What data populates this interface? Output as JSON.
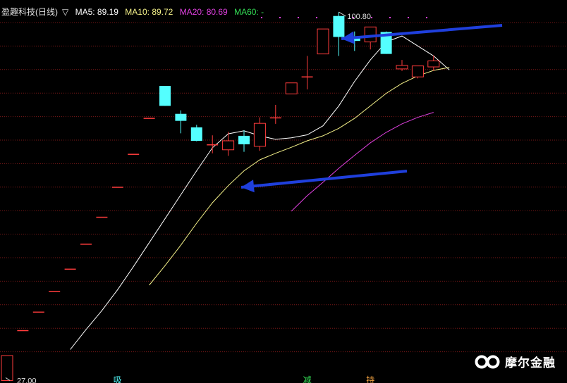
{
  "header": {
    "name": "盈趣科技(日线)",
    "marker": "▽",
    "ma5_label": "MA5: 89.19",
    "ma10_label": "MA10: 89.72",
    "ma20_label": "MA20: 80.69",
    "ma60_label": "MA60: -"
  },
  "watermark": {
    "text": "摩尔金融",
    "logo": "infinity-logo"
  },
  "colors": {
    "up": "#ff3c3c",
    "down": "#54ffff",
    "ma5": "#ffffff",
    "ma10": "#f5f28a",
    "ma20": "#e040e0",
    "arrow": "#1f3fdc",
    "grid": "#7a1818"
  },
  "chart_data": {
    "type": "candlestick",
    "ylim": [
      26.5,
      103.2
    ],
    "annotations": {
      "high_label": "100.80",
      "low_label": "27.00"
    },
    "candles": [
      {
        "o": 27.0,
        "c": 32.0,
        "h": 32.0,
        "l": 27.0
      },
      {
        "o": 37.1,
        "c": 37.1,
        "h": 37.1,
        "l": 37.1
      },
      {
        "o": 40.8,
        "c": 40.8,
        "h": 40.8,
        "l": 40.8
      },
      {
        "o": 44.9,
        "c": 44.9,
        "h": 44.9,
        "l": 44.9
      },
      {
        "o": 49.4,
        "c": 49.4,
        "h": 49.4,
        "l": 49.4
      },
      {
        "o": 54.4,
        "c": 54.4,
        "h": 54.4,
        "l": 54.4
      },
      {
        "o": 59.8,
        "c": 59.8,
        "h": 59.8,
        "l": 59.8
      },
      {
        "o": 65.8,
        "c": 65.8,
        "h": 65.8,
        "l": 65.8
      },
      {
        "o": 72.4,
        "c": 72.4,
        "h": 72.4,
        "l": 72.4
      },
      {
        "o": 79.6,
        "c": 79.6,
        "h": 79.6,
        "l": 79.6
      },
      {
        "o": 86.0,
        "c": 82.0,
        "h": 86.0,
        "l": 82.0
      },
      {
        "o": 80.4,
        "c": 79.0,
        "h": 81.1,
        "l": 76.5
      },
      {
        "o": 77.7,
        "c": 75.0,
        "h": 78.2,
        "l": 74.9
      },
      {
        "o": 74.3,
        "c": 74.3,
        "h": 76.1,
        "l": 72.5
      },
      {
        "o": 73.2,
        "c": 75.0,
        "h": 76.8,
        "l": 72.0
      },
      {
        "o": 76.0,
        "c": 74.3,
        "h": 77.1,
        "l": 72.8
      },
      {
        "o": 73.9,
        "c": 78.5,
        "h": 79.7,
        "l": 73.0
      },
      {
        "o": 79.7,
        "c": 79.7,
        "h": 82.2,
        "l": 78.4
      },
      {
        "o": 84.4,
        "c": 86.6,
        "h": 86.6,
        "l": 84.4
      },
      {
        "o": 87.9,
        "c": 87.9,
        "h": 92.0,
        "l": 85.3
      },
      {
        "o": 92.4,
        "c": 97.4,
        "h": 97.4,
        "l": 92.4
      },
      {
        "o": 100.0,
        "c": 95.8,
        "h": 100.8,
        "l": 92.0
      },
      {
        "o": 95.8,
        "c": 95.0,
        "h": 96.9,
        "l": 93.0
      },
      {
        "o": 94.8,
        "c": 97.8,
        "h": 97.8,
        "l": 93.3
      },
      {
        "o": 96.8,
        "c": 92.4,
        "h": 96.9,
        "l": 92.4
      },
      {
        "o": 89.4,
        "c": 90.1,
        "h": 91.2,
        "l": 89.0
      },
      {
        "o": 87.8,
        "c": 90.0,
        "h": 90.0,
        "l": 87.5
      },
      {
        "o": 89.8,
        "c": 91.0,
        "h": 92.1,
        "l": 89.0
      }
    ],
    "series": [
      {
        "name": "MA5",
        "values": [
          null,
          null,
          null,
          null,
          33.2,
          37.2,
          41.0,
          45.2,
          49.8,
          54.6,
          59.4,
          64.2,
          69.0,
          73.6,
          76.4,
          77.0,
          76.0,
          75.3,
          75.6,
          76.2,
          78.0,
          82.0,
          86.9,
          91.2,
          94.8,
          96.0,
          94.0,
          92.0,
          89.2
        ]
      },
      {
        "name": "MA10",
        "values": [
          null,
          null,
          null,
          null,
          null,
          null,
          null,
          null,
          null,
          46.1,
          50.0,
          54.1,
          58.5,
          62.6,
          66.0,
          69.0,
          71.2,
          72.5,
          73.7,
          75.0,
          76.0,
          77.5,
          79.5,
          82.0,
          84.5,
          86.5,
          88.0,
          89.1,
          89.7
        ]
      },
      {
        "name": "MA20",
        "values": [
          null,
          null,
          null,
          null,
          null,
          null,
          null,
          null,
          null,
          null,
          null,
          null,
          null,
          null,
          null,
          null,
          null,
          null,
          60.9,
          64.0,
          66.7,
          69.5,
          72.1,
          74.6,
          76.7,
          78.4,
          79.7,
          80.7
        ]
      }
    ],
    "signal_marks": [
      {
        "index": 7,
        "label": "吸"
      },
      {
        "index": 19,
        "label": "减"
      },
      {
        "index": 23,
        "label": "持"
      }
    ]
  }
}
